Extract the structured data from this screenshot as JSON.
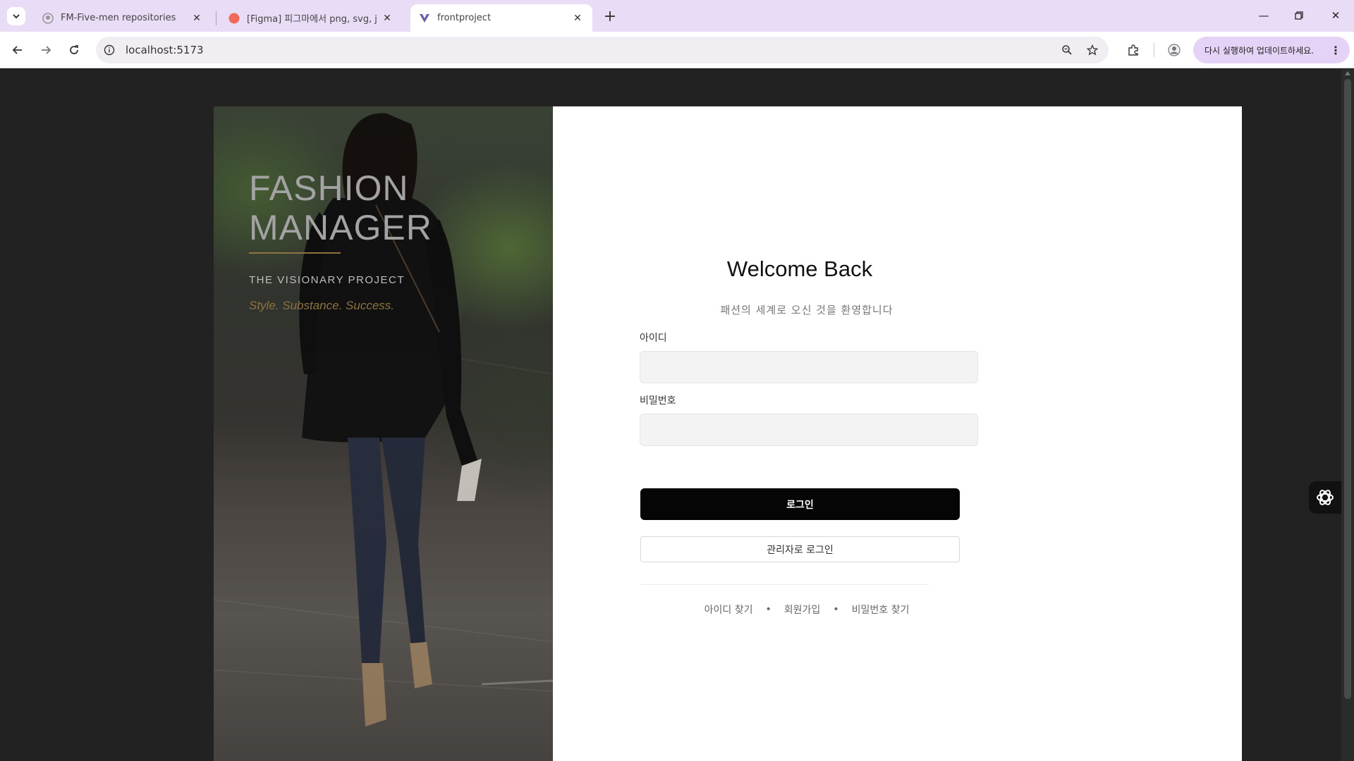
{
  "browser": {
    "tabs": [
      {
        "title": "FM-Five-men repositories",
        "icon": "github-icon"
      },
      {
        "title": "[Figma] 피그마에서 png, svg, j",
        "icon": "figma-icon"
      },
      {
        "title": "frontproject",
        "icon": "vite-icon"
      }
    ],
    "url": "localhost:5173",
    "update_label": "다시 실행하여 업데이트하세요."
  },
  "hero": {
    "brand_line1": "FASHION",
    "brand_line2": "MANAGER",
    "subtitle": "THE VISIONARY PROJECT",
    "tagline": "Style. Substance. Success."
  },
  "login": {
    "title": "Welcome Back",
    "subtitle": "패션의 세계로 오신 것을 환영합니다",
    "id_label": "아이디",
    "id_value": "",
    "password_label": "비밀번호",
    "password_value": "",
    "login_button": "로그인",
    "admin_button": "관리자로 로그인",
    "links": [
      "아이디 찾기",
      "회원가입",
      "비밀번호 찾기"
    ]
  },
  "colors": {
    "chrome_tabstrip": "#e9dcf6",
    "update_pill": "#e4d3f7",
    "page_bg": "#222222",
    "accent_gold": "#8f7440",
    "login_button_bg": "#050505"
  }
}
